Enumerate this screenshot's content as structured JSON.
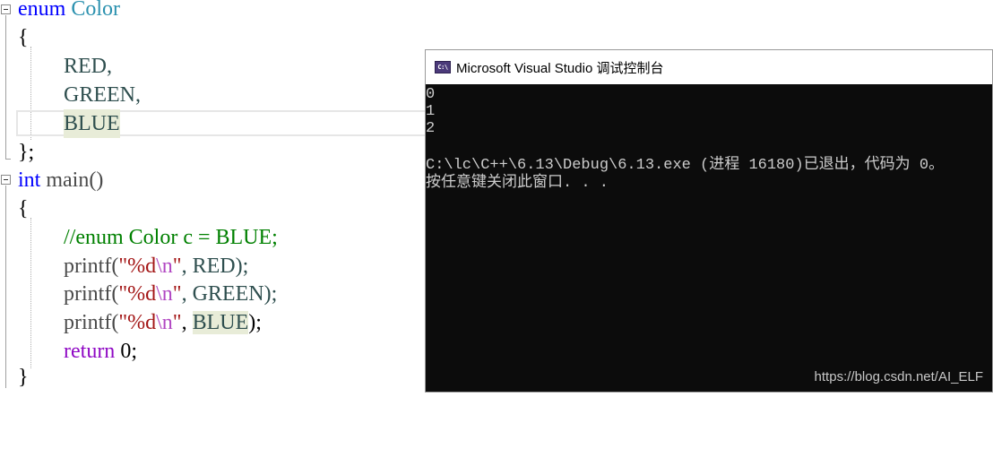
{
  "editor": {
    "l1": {
      "kw": "enum",
      "name": "Color"
    },
    "l2": "{",
    "l3": "RED,",
    "l4": "GREEN,",
    "l5": "BLUE",
    "l6": "};",
    "l7": {
      "kw": "int",
      "rest": "main()"
    },
    "l8": "{",
    "l9": "//enum Color c = BLUE;",
    "l10": {
      "fn": "printf(",
      "q1": "\"%d",
      "esc": "\\n",
      "q2": "\"",
      "rest": ", RED);"
    },
    "l11": {
      "fn": "printf(",
      "q1": "\"%d",
      "esc": "\\n",
      "q2": "\"",
      "rest": ", GREEN);"
    },
    "l12": {
      "fn": "printf(",
      "q1": "\"%d",
      "esc": "\\n",
      "q2": "\"",
      "sep": ", ",
      "arg": "BLUE",
      "end": ");"
    },
    "l13": {
      "kw": "return",
      "rest": " 0;"
    },
    "l14": "}"
  },
  "console": {
    "icon_text": "C:\\",
    "title": "Microsoft Visual Studio 调试控制台",
    "lines": [
      "0",
      "1",
      "2",
      "",
      "C:\\lc\\C++\\6.13\\Debug\\6.13.exe (进程 16180)已退出，代码为 0。",
      "按任意键关闭此窗口. . ."
    ]
  },
  "watermark": "https://blog.csdn.net/AI_ELF"
}
